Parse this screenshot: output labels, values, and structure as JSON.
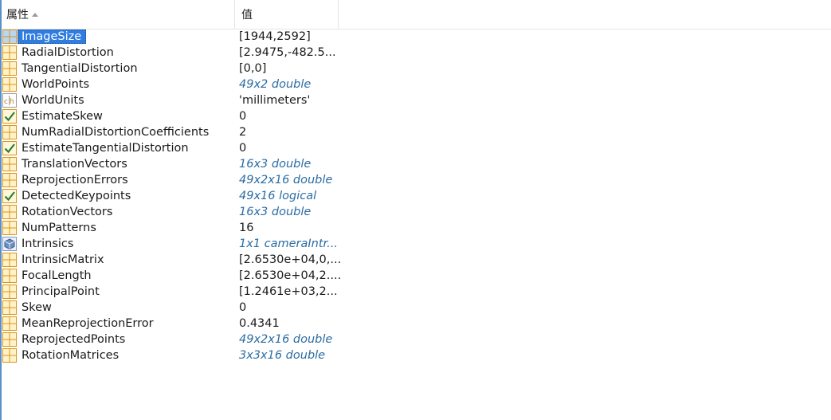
{
  "header": {
    "property_label": "属性",
    "value_label": "值"
  },
  "rows": [
    {
      "name": "ImageSize",
      "value": "[1944,2592]",
      "type": "matrix",
      "link": false,
      "selected": true
    },
    {
      "name": "RadialDistortion",
      "value": "[2.9475,-482.5...",
      "type": "matrix",
      "link": false
    },
    {
      "name": "TangentialDistortion",
      "value": "[0,0]",
      "type": "matrix",
      "link": false
    },
    {
      "name": "WorldPoints",
      "value": "49x2 double",
      "type": "matrix",
      "link": true
    },
    {
      "name": "WorldUnits",
      "value": "'millimeters'",
      "type": "char",
      "link": false
    },
    {
      "name": "EstimateSkew",
      "value": "0",
      "type": "logical",
      "link": false
    },
    {
      "name": "NumRadialDistortionCoefficients",
      "value": "2",
      "type": "matrix",
      "link": false
    },
    {
      "name": "EstimateTangentialDistortion",
      "value": "0",
      "type": "logical",
      "link": false
    },
    {
      "name": "TranslationVectors",
      "value": "16x3 double",
      "type": "matrix",
      "link": true
    },
    {
      "name": "ReprojectionErrors",
      "value": "49x2x16 double",
      "type": "matrix",
      "link": true
    },
    {
      "name": "DetectedKeypoints",
      "value": "49x16 logical",
      "type": "logical",
      "link": true
    },
    {
      "name": "RotationVectors",
      "value": "16x3 double",
      "type": "matrix",
      "link": true
    },
    {
      "name": "NumPatterns",
      "value": "16",
      "type": "matrix",
      "link": false
    },
    {
      "name": "Intrinsics",
      "value": "1x1 cameraIntr...",
      "type": "object",
      "link": true
    },
    {
      "name": "IntrinsicMatrix",
      "value": "[2.6530e+04,0,...",
      "type": "matrix",
      "link": false
    },
    {
      "name": "FocalLength",
      "value": "[2.6530e+04,2....",
      "type": "matrix",
      "link": false
    },
    {
      "name": "PrincipalPoint",
      "value": "[1.2461e+03,2...",
      "type": "matrix",
      "link": false
    },
    {
      "name": "Skew",
      "value": "0",
      "type": "matrix",
      "link": false
    },
    {
      "name": "MeanReprojectionError",
      "value": "0.4341",
      "type": "matrix",
      "link": false
    },
    {
      "name": "ReprojectedPoints",
      "value": "49x2x16 double",
      "type": "matrix",
      "link": true
    },
    {
      "name": "RotationMatrices",
      "value": "3x3x16 double",
      "type": "matrix",
      "link": true
    }
  ],
  "colors": {
    "link": "#2b6ca3",
    "selection": "#2f7de1",
    "matrix_icon": "#e8a317",
    "check": "#2f7d2f"
  }
}
